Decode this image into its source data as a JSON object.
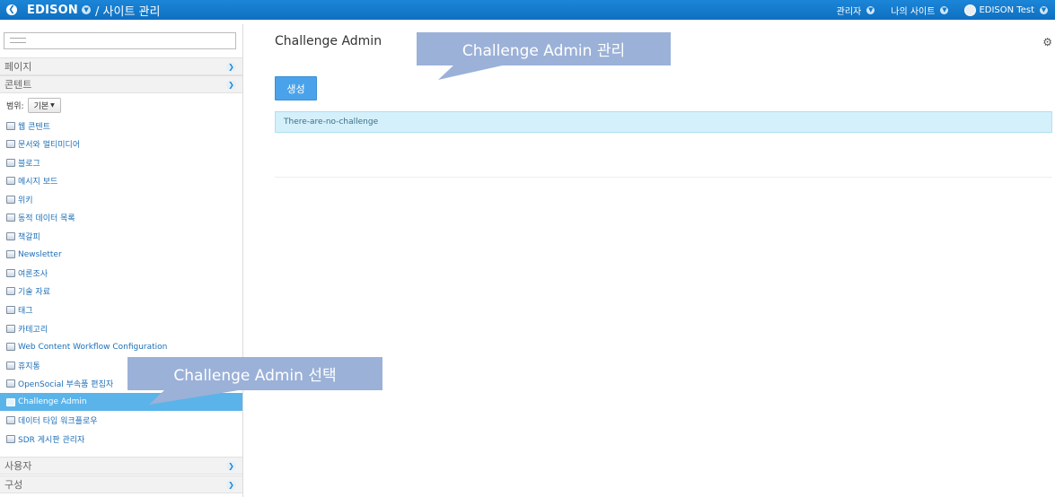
{
  "topbar": {
    "back_icon": "back-circle-icon",
    "site_name": "EDISON",
    "breadcrumb": "/ 사이트 관리",
    "admin_menu": "관리자",
    "my_sites_menu": "나의 사이트",
    "user_name": "EDISON Test"
  },
  "sidebar": {
    "sections": {
      "pages": "페이지",
      "content": "콘텐트",
      "users": "사용자",
      "configuration": "구성"
    },
    "scope_label": "범위:",
    "scope_value": "기본",
    "items": [
      {
        "label": "웹 콘텐트",
        "icon": "web-content-icon"
      },
      {
        "label": "문서와 멀티미디어",
        "icon": "documents-icon"
      },
      {
        "label": "블로그",
        "icon": "blog-icon"
      },
      {
        "label": "메시지 보드",
        "icon": "message-board-icon"
      },
      {
        "label": "위키",
        "icon": "wiki-icon"
      },
      {
        "label": "동적 데이터 목록",
        "icon": "dynamic-data-icon"
      },
      {
        "label": "책갈피",
        "icon": "bookmarks-icon"
      },
      {
        "label": "Newsletter",
        "icon": "newsletter-icon"
      },
      {
        "label": "여론조사",
        "icon": "polls-icon"
      },
      {
        "label": "기술 자료",
        "icon": "knowledge-base-icon"
      },
      {
        "label": "태그",
        "icon": "tags-icon"
      },
      {
        "label": "카테고리",
        "icon": "categories-icon"
      },
      {
        "label": "Web Content Workflow Configuration",
        "icon": "workflow-icon"
      },
      {
        "label": "휴지통",
        "icon": "trash-icon"
      },
      {
        "label": "OpenSocial 부속품 편집자",
        "icon": "opensocial-icon"
      },
      {
        "label": "Challenge Admin",
        "icon": "challenge-icon"
      },
      {
        "label": "데이터 타입 워크플로우",
        "icon": "data-type-icon"
      },
      {
        "label": "SDR 게시판 관리자",
        "icon": "sdr-board-icon"
      }
    ]
  },
  "main": {
    "title": "Challenge Admin",
    "create_button": "생성",
    "empty_message": "There-are-no-challenge"
  },
  "annotations": {
    "manage_callout": "Challenge Admin 관리",
    "select_callout": "Challenge Admin 선택"
  },
  "colors": {
    "topbar": "#1479c9",
    "selected_item": "#5ab4ea",
    "create_button": "#4aa3ea",
    "callout": "#9bb1d8"
  }
}
